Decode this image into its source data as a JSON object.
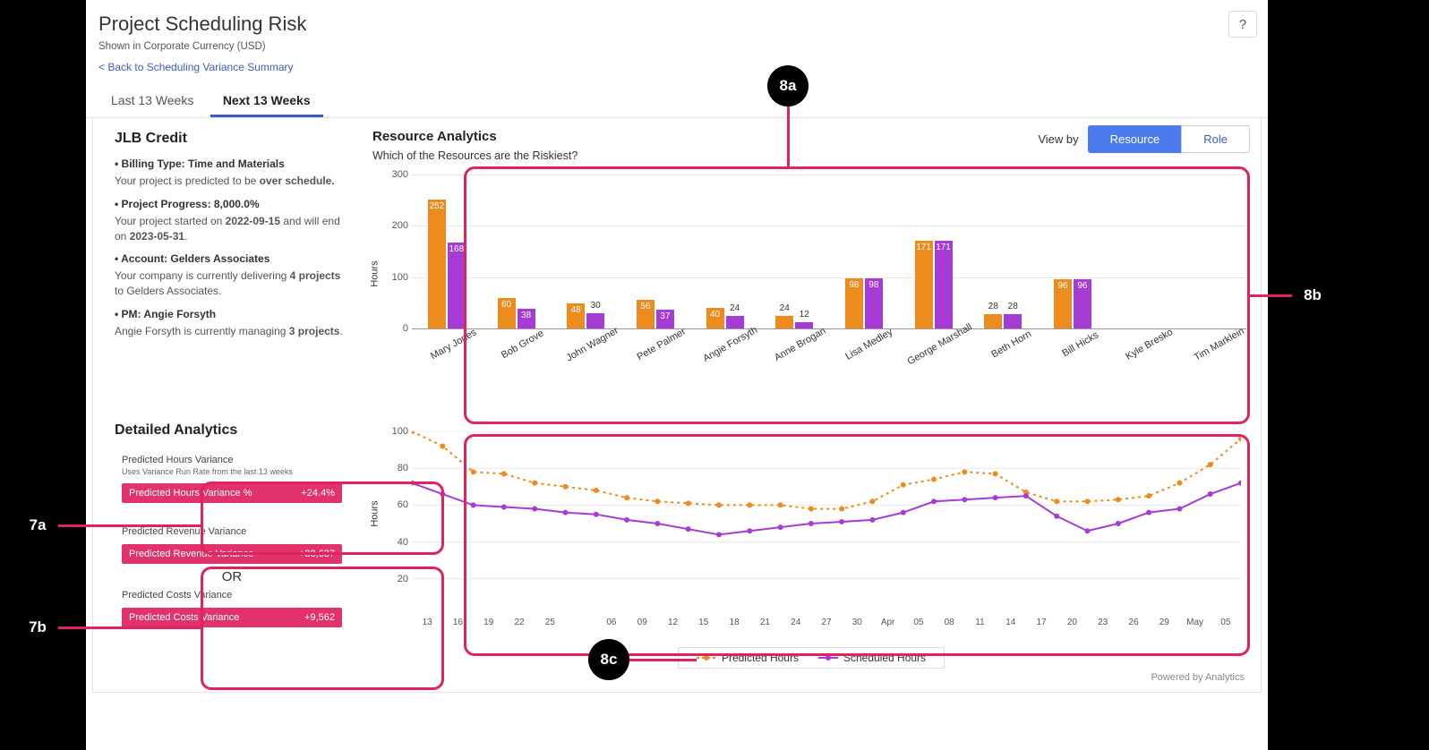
{
  "page": {
    "title": "Project Scheduling Risk",
    "subtitle": "Shown in Corporate Currency (USD)",
    "back_link": "< Back to Scheduling Variance Summary",
    "help": "?"
  },
  "tabs": {
    "last": "Last 13 Weeks",
    "next": "Next 13 Weeks"
  },
  "project": {
    "name": "JLB Credit",
    "billing_label": "• Billing Type: Time and Materials",
    "billing_desc_pre": "Your project is predicted to be ",
    "billing_desc_bold": "over schedule.",
    "progress_label": "• Project Progress: 8,000.0%",
    "progress_desc_pre": "Your project started on ",
    "progress_start": "2022-09-15",
    "progress_mid": " and will end on ",
    "progress_end": "2023-05-31",
    "progress_dot": ".",
    "account_label": "• Account: Gelders Associates",
    "account_desc_pre": "Your company is currently delivering ",
    "account_count": "4 projects",
    "account_desc_post": " to Gelders Associates.",
    "pm_label": "• PM: Angie Forsyth",
    "pm_desc_pre": "Angie Forsyth is currently managing ",
    "pm_count": "3 projects",
    "pm_dot": "."
  },
  "resource_analytics": {
    "title": "Resource Analytics",
    "question": "Which of the Resources are the Riskiest?",
    "view_by": "View by",
    "btn_resource": "Resource",
    "btn_role": "Role",
    "y_label": "Hours"
  },
  "detailed": {
    "title": "Detailed Analytics",
    "card1_title": "Predicted Hours Variance",
    "card1_sub": "Uses Variance Run Rate from the last 13 weeks",
    "card1_pill_label": "Predicted Hours Variance %",
    "card1_pill_value": "+24.4%",
    "card2_title": "Predicted Revenue Variance",
    "card2_pill1_label": "Predicted Revenue Variance",
    "card2_pill1_value": "+38,637",
    "or": "OR",
    "card2_sub": "Predicted Costs Variance",
    "card2_pill2_label": "Predicted Costs Variance",
    "card2_pill2_value": "+9,562"
  },
  "line_chart": {
    "y_label": "Hours",
    "legend_predicted": "Predicted Hours",
    "legend_scheduled": "Scheduled Hours"
  },
  "powered": "Powered by Analytics",
  "annotations": {
    "a7a": "7a",
    "a7b": "7b",
    "a8a": "8a",
    "a8b": "8b",
    "a8c": "8c"
  },
  "chart_data": [
    {
      "id": "resource-bar-chart",
      "type": "bar",
      "title": "Which of the Resources are the Riskiest?",
      "ylabel": "Hours",
      "ylim": [
        0,
        300
      ],
      "y_ticks": [
        0,
        100,
        200,
        300
      ],
      "categories": [
        "Mary Jones",
        "Bob Grove",
        "John Wagner",
        "Pete Palmer",
        "Angie Forsyth",
        "Anne Brogan",
        "Lisa Medley",
        "George Marshall",
        "Beth Horn",
        "Bill Hicks",
        "Kyle Bresko",
        "Tim Marklein"
      ],
      "series": [
        {
          "name": "Predicted",
          "color": "#ed8b1c",
          "values": [
            252,
            60,
            48,
            56,
            40,
            24,
            98,
            171,
            28,
            96,
            0,
            0
          ]
        },
        {
          "name": "Scheduled",
          "color": "#a63bd6",
          "values": [
            168,
            38,
            30,
            37,
            24,
            12,
            98,
            171,
            28,
            96,
            0,
            0
          ]
        }
      ]
    },
    {
      "id": "hours-line-chart",
      "type": "line",
      "ylabel": "Hours",
      "ylim": [
        0,
        100
      ],
      "y_ticks": [
        20,
        40,
        60,
        80,
        100
      ],
      "x_labels": [
        "13",
        "16",
        "19",
        "22",
        "25",
        "",
        "06",
        "09",
        "12",
        "15",
        "18",
        "21",
        "24",
        "27",
        "30",
        "Apr",
        "05",
        "08",
        "11",
        "14",
        "17",
        "20",
        "23",
        "26",
        "29",
        "May",
        "05"
      ],
      "series": [
        {
          "name": "Predicted Hours",
          "color": "#ed8b1c",
          "style": "dotted",
          "values": [
            100,
            92,
            78,
            77,
            72,
            70,
            68,
            64,
            62,
            61,
            60,
            60,
            60,
            58,
            58,
            62,
            71,
            74,
            78,
            77,
            67,
            62,
            62,
            63,
            65,
            72,
            82,
            96
          ]
        },
        {
          "name": "Scheduled Hours",
          "color": "#a63bd6",
          "style": "solid",
          "values": [
            72,
            66,
            60,
            59,
            58,
            56,
            55,
            52,
            50,
            47,
            44,
            46,
            48,
            50,
            51,
            52,
            56,
            62,
            63,
            64,
            65,
            54,
            46,
            50,
            56,
            58,
            66,
            72
          ]
        }
      ]
    }
  ]
}
